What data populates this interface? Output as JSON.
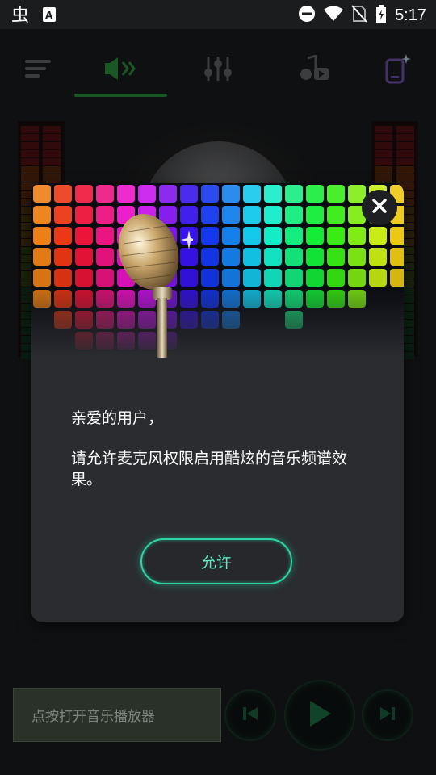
{
  "status_bar": {
    "time": "5:17",
    "icons": [
      "app-logo-icon",
      "keyboard-a-icon",
      "do-not-disturb-icon",
      "wifi-icon",
      "no-sim-icon",
      "battery-charging-icon"
    ]
  },
  "tabs": [
    {
      "icon": "menu-lines-icon",
      "active": false
    },
    {
      "icon": "speaker-icon",
      "active": true
    },
    {
      "icon": "equalizer-sliders-icon",
      "active": false
    },
    {
      "icon": "music-video-icon",
      "active": false
    },
    {
      "icon": "phone-sparkle-icon",
      "active": false
    }
  ],
  "colors": {
    "accent_green": "#2f9e44",
    "allow_button": "#2dd4a6",
    "dialog_bg": "#2a2c30"
  },
  "dialog": {
    "greeting": "亲爱的用户，",
    "message": "请允许麦克风权限启用酷炫的音乐频谱效果。",
    "allow_label": "允许",
    "close_icon": "close-icon",
    "banner_image": "microphone-equalizer-banner"
  },
  "player": {
    "label": "点按打开音乐播放器",
    "prev_icon": "skip-previous-icon",
    "play_icon": "play-icon",
    "next_icon": "skip-next-icon"
  }
}
